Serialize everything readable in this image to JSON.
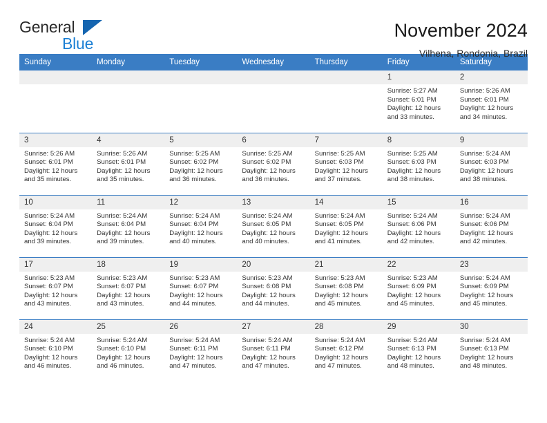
{
  "brand": {
    "word_one": "General",
    "word_two": "Blue",
    "logo_icon": "triangle-logo-icon",
    "accent_color": "#1b7fd4"
  },
  "header": {
    "title": "November 2024",
    "subtitle": "Vilhena, Rondonia, Brazil"
  },
  "theme": {
    "header_blue": "#3a7dc4",
    "daynum_band": "#efefef",
    "text": "#333333"
  },
  "calendar": {
    "weekday_headers": [
      "Sunday",
      "Monday",
      "Tuesday",
      "Wednesday",
      "Thursday",
      "Friday",
      "Saturday"
    ],
    "weeks": [
      [
        {
          "day": "",
          "sunrise": "",
          "sunset": "",
          "daylight_line1": "",
          "daylight_line2": ""
        },
        {
          "day": "",
          "sunrise": "",
          "sunset": "",
          "daylight_line1": "",
          "daylight_line2": ""
        },
        {
          "day": "",
          "sunrise": "",
          "sunset": "",
          "daylight_line1": "",
          "daylight_line2": ""
        },
        {
          "day": "",
          "sunrise": "",
          "sunset": "",
          "daylight_line1": "",
          "daylight_line2": ""
        },
        {
          "day": "",
          "sunrise": "",
          "sunset": "",
          "daylight_line1": "",
          "daylight_line2": ""
        },
        {
          "day": "1",
          "sunrise": "Sunrise: 5:27 AM",
          "sunset": "Sunset: 6:01 PM",
          "daylight_line1": "Daylight: 12 hours",
          "daylight_line2": "and 33 minutes."
        },
        {
          "day": "2",
          "sunrise": "Sunrise: 5:26 AM",
          "sunset": "Sunset: 6:01 PM",
          "daylight_line1": "Daylight: 12 hours",
          "daylight_line2": "and 34 minutes."
        }
      ],
      [
        {
          "day": "3",
          "sunrise": "Sunrise: 5:26 AM",
          "sunset": "Sunset: 6:01 PM",
          "daylight_line1": "Daylight: 12 hours",
          "daylight_line2": "and 35 minutes."
        },
        {
          "day": "4",
          "sunrise": "Sunrise: 5:26 AM",
          "sunset": "Sunset: 6:01 PM",
          "daylight_line1": "Daylight: 12 hours",
          "daylight_line2": "and 35 minutes."
        },
        {
          "day": "5",
          "sunrise": "Sunrise: 5:25 AM",
          "sunset": "Sunset: 6:02 PM",
          "daylight_line1": "Daylight: 12 hours",
          "daylight_line2": "and 36 minutes."
        },
        {
          "day": "6",
          "sunrise": "Sunrise: 5:25 AM",
          "sunset": "Sunset: 6:02 PM",
          "daylight_line1": "Daylight: 12 hours",
          "daylight_line2": "and 36 minutes."
        },
        {
          "day": "7",
          "sunrise": "Sunrise: 5:25 AM",
          "sunset": "Sunset: 6:03 PM",
          "daylight_line1": "Daylight: 12 hours",
          "daylight_line2": "and 37 minutes."
        },
        {
          "day": "8",
          "sunrise": "Sunrise: 5:25 AM",
          "sunset": "Sunset: 6:03 PM",
          "daylight_line1": "Daylight: 12 hours",
          "daylight_line2": "and 38 minutes."
        },
        {
          "day": "9",
          "sunrise": "Sunrise: 5:24 AM",
          "sunset": "Sunset: 6:03 PM",
          "daylight_line1": "Daylight: 12 hours",
          "daylight_line2": "and 38 minutes."
        }
      ],
      [
        {
          "day": "10",
          "sunrise": "Sunrise: 5:24 AM",
          "sunset": "Sunset: 6:04 PM",
          "daylight_line1": "Daylight: 12 hours",
          "daylight_line2": "and 39 minutes."
        },
        {
          "day": "11",
          "sunrise": "Sunrise: 5:24 AM",
          "sunset": "Sunset: 6:04 PM",
          "daylight_line1": "Daylight: 12 hours",
          "daylight_line2": "and 39 minutes."
        },
        {
          "day": "12",
          "sunrise": "Sunrise: 5:24 AM",
          "sunset": "Sunset: 6:04 PM",
          "daylight_line1": "Daylight: 12 hours",
          "daylight_line2": "and 40 minutes."
        },
        {
          "day": "13",
          "sunrise": "Sunrise: 5:24 AM",
          "sunset": "Sunset: 6:05 PM",
          "daylight_line1": "Daylight: 12 hours",
          "daylight_line2": "and 40 minutes."
        },
        {
          "day": "14",
          "sunrise": "Sunrise: 5:24 AM",
          "sunset": "Sunset: 6:05 PM",
          "daylight_line1": "Daylight: 12 hours",
          "daylight_line2": "and 41 minutes."
        },
        {
          "day": "15",
          "sunrise": "Sunrise: 5:24 AM",
          "sunset": "Sunset: 6:06 PM",
          "daylight_line1": "Daylight: 12 hours",
          "daylight_line2": "and 42 minutes."
        },
        {
          "day": "16",
          "sunrise": "Sunrise: 5:24 AM",
          "sunset": "Sunset: 6:06 PM",
          "daylight_line1": "Daylight: 12 hours",
          "daylight_line2": "and 42 minutes."
        }
      ],
      [
        {
          "day": "17",
          "sunrise": "Sunrise: 5:23 AM",
          "sunset": "Sunset: 6:07 PM",
          "daylight_line1": "Daylight: 12 hours",
          "daylight_line2": "and 43 minutes."
        },
        {
          "day": "18",
          "sunrise": "Sunrise: 5:23 AM",
          "sunset": "Sunset: 6:07 PM",
          "daylight_line1": "Daylight: 12 hours",
          "daylight_line2": "and 43 minutes."
        },
        {
          "day": "19",
          "sunrise": "Sunrise: 5:23 AM",
          "sunset": "Sunset: 6:07 PM",
          "daylight_line1": "Daylight: 12 hours",
          "daylight_line2": "and 44 minutes."
        },
        {
          "day": "20",
          "sunrise": "Sunrise: 5:23 AM",
          "sunset": "Sunset: 6:08 PM",
          "daylight_line1": "Daylight: 12 hours",
          "daylight_line2": "and 44 minutes."
        },
        {
          "day": "21",
          "sunrise": "Sunrise: 5:23 AM",
          "sunset": "Sunset: 6:08 PM",
          "daylight_line1": "Daylight: 12 hours",
          "daylight_line2": "and 45 minutes."
        },
        {
          "day": "22",
          "sunrise": "Sunrise: 5:23 AM",
          "sunset": "Sunset: 6:09 PM",
          "daylight_line1": "Daylight: 12 hours",
          "daylight_line2": "and 45 minutes."
        },
        {
          "day": "23",
          "sunrise": "Sunrise: 5:24 AM",
          "sunset": "Sunset: 6:09 PM",
          "daylight_line1": "Daylight: 12 hours",
          "daylight_line2": "and 45 minutes."
        }
      ],
      [
        {
          "day": "24",
          "sunrise": "Sunrise: 5:24 AM",
          "sunset": "Sunset: 6:10 PM",
          "daylight_line1": "Daylight: 12 hours",
          "daylight_line2": "and 46 minutes."
        },
        {
          "day": "25",
          "sunrise": "Sunrise: 5:24 AM",
          "sunset": "Sunset: 6:10 PM",
          "daylight_line1": "Daylight: 12 hours",
          "daylight_line2": "and 46 minutes."
        },
        {
          "day": "26",
          "sunrise": "Sunrise: 5:24 AM",
          "sunset": "Sunset: 6:11 PM",
          "daylight_line1": "Daylight: 12 hours",
          "daylight_line2": "and 47 minutes."
        },
        {
          "day": "27",
          "sunrise": "Sunrise: 5:24 AM",
          "sunset": "Sunset: 6:11 PM",
          "daylight_line1": "Daylight: 12 hours",
          "daylight_line2": "and 47 minutes."
        },
        {
          "day": "28",
          "sunrise": "Sunrise: 5:24 AM",
          "sunset": "Sunset: 6:12 PM",
          "daylight_line1": "Daylight: 12 hours",
          "daylight_line2": "and 47 minutes."
        },
        {
          "day": "29",
          "sunrise": "Sunrise: 5:24 AM",
          "sunset": "Sunset: 6:13 PM",
          "daylight_line1": "Daylight: 12 hours",
          "daylight_line2": "and 48 minutes."
        },
        {
          "day": "30",
          "sunrise": "Sunrise: 5:24 AM",
          "sunset": "Sunset: 6:13 PM",
          "daylight_line1": "Daylight: 12 hours",
          "daylight_line2": "and 48 minutes."
        }
      ]
    ]
  }
}
